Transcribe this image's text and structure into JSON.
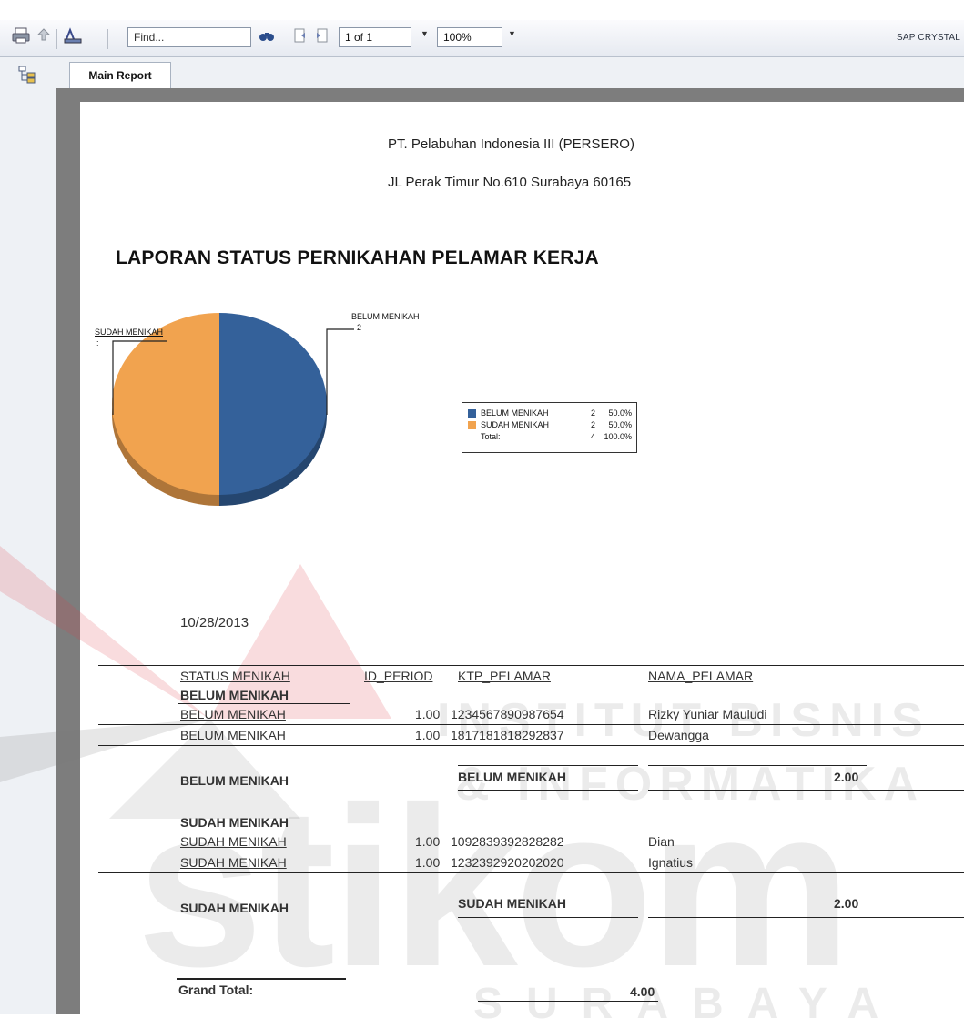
{
  "toolbar": {
    "find_placeholder": "Find...",
    "page_value": "1 of 1",
    "zoom_value": "100%",
    "brand": "SAP CRYSTAL"
  },
  "tabs": {
    "main_report": "Main Report"
  },
  "report": {
    "company": "PT. Pelabuhan Indonesia III (PERSERO)",
    "address": "JL Perak Timur No.610 Surabaya 60165",
    "title": "LAPORAN STATUS PERNIKAHAN PELAMAR KERJA",
    "date": "10/28/2013",
    "columns": [
      "STATUS MENIKAH",
      "ID_PERIOD",
      "KTP_PELAMAR",
      "NAMA_PELAMAR"
    ],
    "groups": [
      {
        "name": "BELUM MENIKAH",
        "rows": [
          {
            "status": "BELUM MENIKAH",
            "id_period": "1.00",
            "ktp": "1234567890987654",
            "nama": "Rizky Yuniar Mauludi"
          },
          {
            "status": "BELUM MENIKAH",
            "id_period": "1.00",
            "ktp": "1817181818292837",
            "nama": "Dewangga"
          }
        ],
        "footer_label": "BELUM MENIKAH",
        "footer_label2": "BELUM MENIKAH",
        "total": "2.00"
      },
      {
        "name": "SUDAH MENIKAH",
        "rows": [
          {
            "status": "SUDAH MENIKAH",
            "id_period": "1.00",
            "ktp": "1092839392828282",
            "nama": "Dian"
          },
          {
            "status": "SUDAH MENIKAH",
            "id_period": "1.00",
            "ktp": "1232392920202020",
            "nama": "Ignatius"
          }
        ],
        "footer_label": "SUDAH MENIKAH",
        "footer_label2": "SUDAH MENIKAH",
        "total": "2.00"
      }
    ],
    "grand_total_label": "Grand Total:",
    "grand_total": "4.00"
  },
  "chart_data": {
    "type": "pie",
    "categories": [
      "BELUM MENIKAH",
      "SUDAH MENIKAH"
    ],
    "values": [
      2,
      2
    ],
    "percentages": [
      "50.0%",
      "50.0%"
    ],
    "colors": [
      "#34619a",
      "#f1a34f"
    ],
    "callouts": [
      {
        "label": "BELUM MENIKAH",
        "value": "2"
      },
      {
        "label": "SUDAH MENIKAH",
        "value": ":"
      }
    ],
    "legend": [
      {
        "label": "BELUM MENIKAH",
        "value": "2",
        "pct": "50.0%"
      },
      {
        "label": "SUDAH MENIKAH",
        "value": "2",
        "pct": "50.0%"
      }
    ],
    "legend_total": {
      "label": "Total:",
      "value": "4",
      "pct": "100.0%"
    },
    "legend_placement": "right"
  },
  "watermark": {
    "line1": "INSTITUT BISNIS",
    "line2": "& INFORMATIKA",
    "line3": "stikom",
    "line4": "SURABAYA"
  }
}
